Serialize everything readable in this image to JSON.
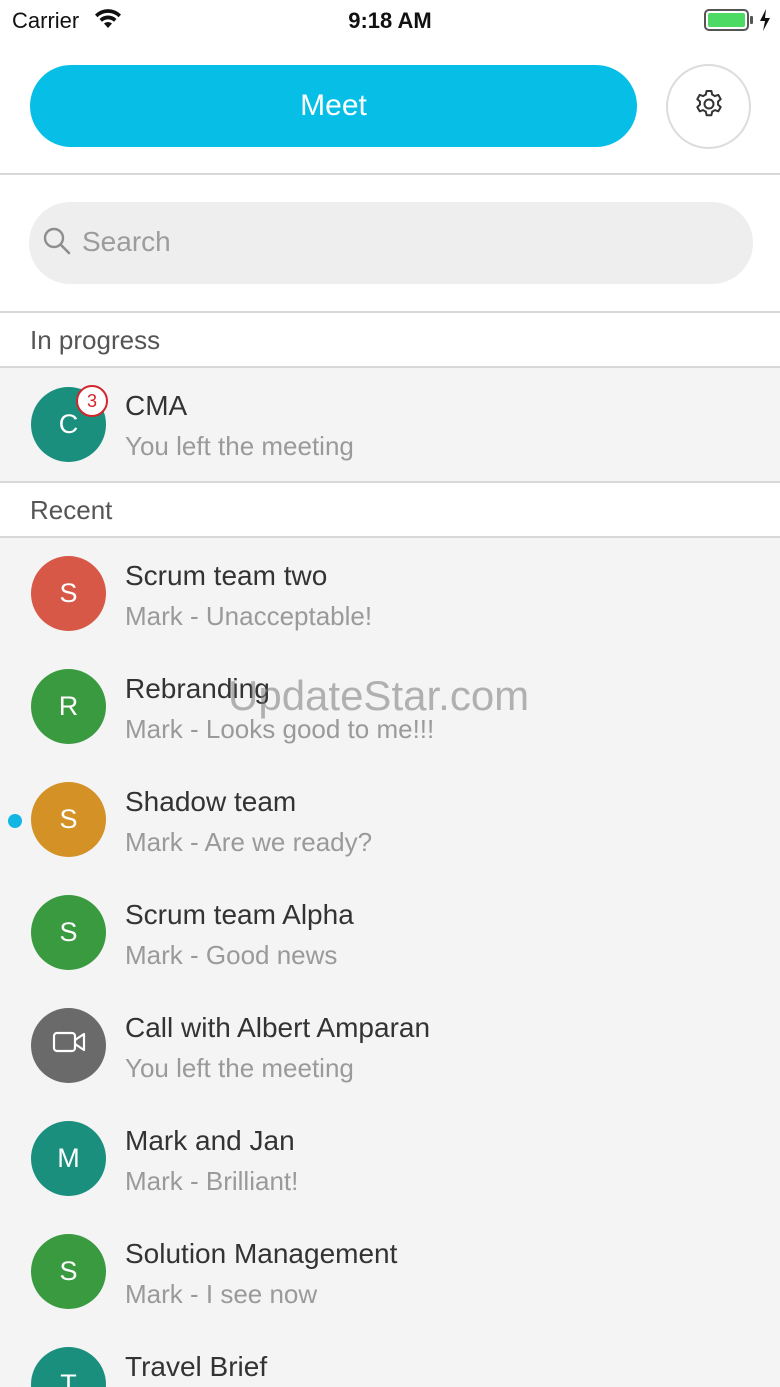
{
  "status_bar": {
    "carrier": "Carrier",
    "time": "9:18 AM",
    "battery_color": "#4cd964"
  },
  "header": {
    "meet_label": "Meet",
    "meet_color": "#07bfe6",
    "settings_icon": "gear-icon"
  },
  "search": {
    "placeholder": "Search",
    "icon": "search-icon"
  },
  "sections": {
    "in_progress": "In progress",
    "recent": "Recent"
  },
  "in_progress": [
    {
      "initial": "C",
      "title": "CMA",
      "subtitle": "You left the meeting",
      "badge": "3",
      "avatar_color": "#1a8f7e"
    }
  ],
  "recent": [
    {
      "initial": "S",
      "title": "Scrum team two",
      "subtitle": "Mark - Unacceptable!",
      "avatar_color": "#d85848",
      "unread": false
    },
    {
      "initial": "R",
      "title": "Rebranding",
      "subtitle": "Mark - Looks good to me!!!",
      "avatar_color": "#3a9a3f",
      "unread": false
    },
    {
      "initial": "S",
      "title": "Shadow team",
      "subtitle": "Mark - Are we ready?",
      "avatar_color": "#d49126",
      "unread": true
    },
    {
      "initial": "S",
      "title": "Scrum team Alpha",
      "subtitle": "Mark - Good news",
      "avatar_color": "#3a9a3f",
      "unread": false
    },
    {
      "initial": "",
      "icon": "video-camera-icon",
      "title": "Call with Albert Amparan",
      "subtitle": "You left the meeting",
      "avatar_color": "#6a6a6a",
      "unread": false
    },
    {
      "initial": "M",
      "title": "Mark and Jan",
      "subtitle": "Mark - Brilliant!",
      "avatar_color": "#1a8f7e",
      "unread": false
    },
    {
      "initial": "S",
      "title": "Solution Management",
      "subtitle": "Mark - I see now",
      "avatar_color": "#3a9a3f",
      "unread": false
    },
    {
      "initial": "T",
      "title": "Travel Brief",
      "subtitle": "",
      "avatar_color": "#1a8f7e",
      "unread": false
    }
  ],
  "watermark": "UpdateStar.com"
}
